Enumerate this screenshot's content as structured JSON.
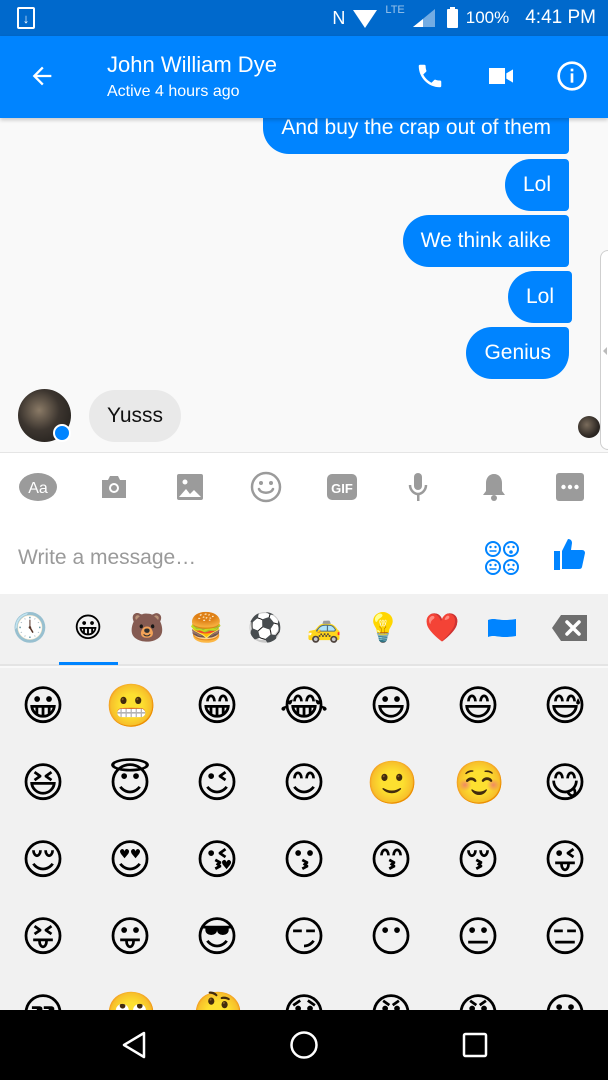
{
  "status_bar": {
    "battery_percent": "100%",
    "time": "4:41 PM",
    "network": "LTE",
    "icons": [
      "download-icon",
      "nfc-icon",
      "wifi-icon",
      "signal-icon",
      "battery-icon"
    ]
  },
  "header": {
    "contact_name": "John William Dye",
    "status": "Active 4 hours ago",
    "icons": [
      "back-arrow-icon",
      "phone-icon",
      "video-camera-icon",
      "info-icon"
    ]
  },
  "conversation": {
    "outgoing": [
      {
        "text": "And buy the crap out of them"
      },
      {
        "text": "Lol"
      },
      {
        "text": "We think alike"
      },
      {
        "text": "Lol"
      },
      {
        "text": "Genius"
      }
    ],
    "incoming": [
      {
        "text": "Yusss"
      }
    ]
  },
  "toolbar": {
    "items": [
      "text-style-icon",
      "camera-icon",
      "gallery-icon",
      "emoji-icon",
      "gif-icon",
      "microphone-icon",
      "bell-icon",
      "more-icon"
    ],
    "text_style_label": "Aa",
    "gif_label": "GIF"
  },
  "composer": {
    "placeholder": "Write a message…",
    "value": ""
  },
  "emoji_picker": {
    "tabs": [
      {
        "name": "recent",
        "glyph": "🕔"
      },
      {
        "name": "smileys",
        "glyph": "😀",
        "selected": true
      },
      {
        "name": "animals",
        "glyph": "🐻"
      },
      {
        "name": "food",
        "glyph": "🍔"
      },
      {
        "name": "activity",
        "glyph": "⚽"
      },
      {
        "name": "travel",
        "glyph": "🚕"
      },
      {
        "name": "objects",
        "glyph": "💡"
      },
      {
        "name": "symbols",
        "glyph": "❤️"
      },
      {
        "name": "flags",
        "glyph": "🏳"
      }
    ],
    "rows": [
      [
        "😀",
        "😬",
        "😁",
        "😂",
        "😃",
        "😄",
        "😅"
      ],
      [
        "😆",
        "😇",
        "😉",
        "😊",
        "🙂",
        "☺️",
        "😋"
      ],
      [
        "😌",
        "😍",
        "😘",
        "😗",
        "😙",
        "😚",
        "😜"
      ],
      [
        "😝",
        "😛",
        "😎",
        "😏",
        "😶",
        "😐",
        "😑"
      ],
      [
        "😒",
        "🙄",
        "🤔",
        "😟",
        "😠",
        "😡",
        "😶"
      ]
    ],
    "colors": {
      "accent": "#0084ff",
      "background": "#f1f1f1"
    }
  },
  "colors": {
    "status_bar": "#0069cc",
    "header": "#0084ff",
    "outgoing_bubble": "#0084ff",
    "incoming_bubble": "#e9e9e9",
    "toolbar_icon": "#9b9b9b"
  }
}
